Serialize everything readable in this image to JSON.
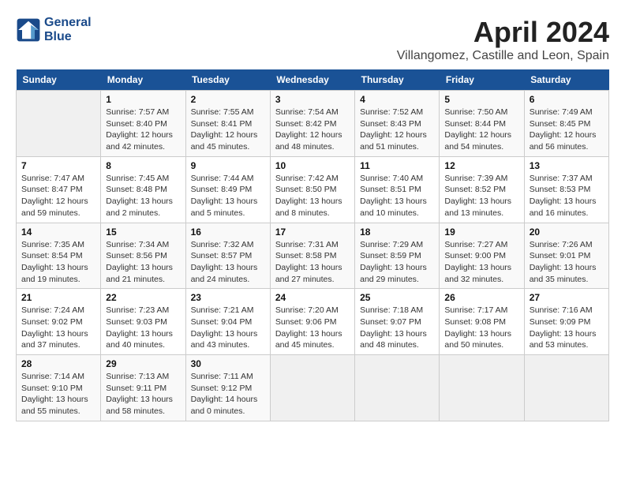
{
  "header": {
    "logo_line1": "General",
    "logo_line2": "Blue",
    "month": "April 2024",
    "location": "Villangomez, Castille and Leon, Spain"
  },
  "weekdays": [
    "Sunday",
    "Monday",
    "Tuesday",
    "Wednesday",
    "Thursday",
    "Friday",
    "Saturday"
  ],
  "weeks": [
    [
      {
        "day": "",
        "info": ""
      },
      {
        "day": "1",
        "info": "Sunrise: 7:57 AM\nSunset: 8:40 PM\nDaylight: 12 hours\nand 42 minutes."
      },
      {
        "day": "2",
        "info": "Sunrise: 7:55 AM\nSunset: 8:41 PM\nDaylight: 12 hours\nand 45 minutes."
      },
      {
        "day": "3",
        "info": "Sunrise: 7:54 AM\nSunset: 8:42 PM\nDaylight: 12 hours\nand 48 minutes."
      },
      {
        "day": "4",
        "info": "Sunrise: 7:52 AM\nSunset: 8:43 PM\nDaylight: 12 hours\nand 51 minutes."
      },
      {
        "day": "5",
        "info": "Sunrise: 7:50 AM\nSunset: 8:44 PM\nDaylight: 12 hours\nand 54 minutes."
      },
      {
        "day": "6",
        "info": "Sunrise: 7:49 AM\nSunset: 8:45 PM\nDaylight: 12 hours\nand 56 minutes."
      }
    ],
    [
      {
        "day": "7",
        "info": "Sunrise: 7:47 AM\nSunset: 8:47 PM\nDaylight: 12 hours\nand 59 minutes."
      },
      {
        "day": "8",
        "info": "Sunrise: 7:45 AM\nSunset: 8:48 PM\nDaylight: 13 hours\nand 2 minutes."
      },
      {
        "day": "9",
        "info": "Sunrise: 7:44 AM\nSunset: 8:49 PM\nDaylight: 13 hours\nand 5 minutes."
      },
      {
        "day": "10",
        "info": "Sunrise: 7:42 AM\nSunset: 8:50 PM\nDaylight: 13 hours\nand 8 minutes."
      },
      {
        "day": "11",
        "info": "Sunrise: 7:40 AM\nSunset: 8:51 PM\nDaylight: 13 hours\nand 10 minutes."
      },
      {
        "day": "12",
        "info": "Sunrise: 7:39 AM\nSunset: 8:52 PM\nDaylight: 13 hours\nand 13 minutes."
      },
      {
        "day": "13",
        "info": "Sunrise: 7:37 AM\nSunset: 8:53 PM\nDaylight: 13 hours\nand 16 minutes."
      }
    ],
    [
      {
        "day": "14",
        "info": "Sunrise: 7:35 AM\nSunset: 8:54 PM\nDaylight: 13 hours\nand 19 minutes."
      },
      {
        "day": "15",
        "info": "Sunrise: 7:34 AM\nSunset: 8:56 PM\nDaylight: 13 hours\nand 21 minutes."
      },
      {
        "day": "16",
        "info": "Sunrise: 7:32 AM\nSunset: 8:57 PM\nDaylight: 13 hours\nand 24 minutes."
      },
      {
        "day": "17",
        "info": "Sunrise: 7:31 AM\nSunset: 8:58 PM\nDaylight: 13 hours\nand 27 minutes."
      },
      {
        "day": "18",
        "info": "Sunrise: 7:29 AM\nSunset: 8:59 PM\nDaylight: 13 hours\nand 29 minutes."
      },
      {
        "day": "19",
        "info": "Sunrise: 7:27 AM\nSunset: 9:00 PM\nDaylight: 13 hours\nand 32 minutes."
      },
      {
        "day": "20",
        "info": "Sunrise: 7:26 AM\nSunset: 9:01 PM\nDaylight: 13 hours\nand 35 minutes."
      }
    ],
    [
      {
        "day": "21",
        "info": "Sunrise: 7:24 AM\nSunset: 9:02 PM\nDaylight: 13 hours\nand 37 minutes."
      },
      {
        "day": "22",
        "info": "Sunrise: 7:23 AM\nSunset: 9:03 PM\nDaylight: 13 hours\nand 40 minutes."
      },
      {
        "day": "23",
        "info": "Sunrise: 7:21 AM\nSunset: 9:04 PM\nDaylight: 13 hours\nand 43 minutes."
      },
      {
        "day": "24",
        "info": "Sunrise: 7:20 AM\nSunset: 9:06 PM\nDaylight: 13 hours\nand 45 minutes."
      },
      {
        "day": "25",
        "info": "Sunrise: 7:18 AM\nSunset: 9:07 PM\nDaylight: 13 hours\nand 48 minutes."
      },
      {
        "day": "26",
        "info": "Sunrise: 7:17 AM\nSunset: 9:08 PM\nDaylight: 13 hours\nand 50 minutes."
      },
      {
        "day": "27",
        "info": "Sunrise: 7:16 AM\nSunset: 9:09 PM\nDaylight: 13 hours\nand 53 minutes."
      }
    ],
    [
      {
        "day": "28",
        "info": "Sunrise: 7:14 AM\nSunset: 9:10 PM\nDaylight: 13 hours\nand 55 minutes."
      },
      {
        "day": "29",
        "info": "Sunrise: 7:13 AM\nSunset: 9:11 PM\nDaylight: 13 hours\nand 58 minutes."
      },
      {
        "day": "30",
        "info": "Sunrise: 7:11 AM\nSunset: 9:12 PM\nDaylight: 14 hours\nand 0 minutes."
      },
      {
        "day": "",
        "info": ""
      },
      {
        "day": "",
        "info": ""
      },
      {
        "day": "",
        "info": ""
      },
      {
        "day": "",
        "info": ""
      }
    ]
  ]
}
